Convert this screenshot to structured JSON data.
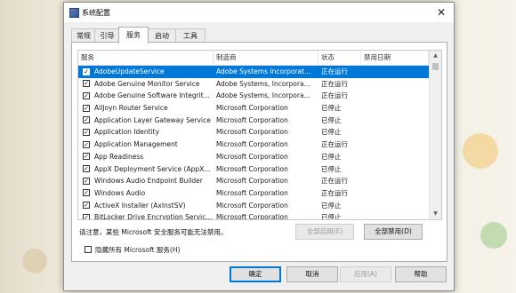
{
  "window": {
    "title": "系统配置",
    "close_glyph": "✕"
  },
  "tabs": [
    {
      "label": "常规",
      "active": false
    },
    {
      "label": "引导",
      "active": false
    },
    {
      "label": "服务",
      "active": true
    },
    {
      "label": "启动",
      "active": false
    },
    {
      "label": "工具",
      "active": false
    }
  ],
  "services": {
    "columns": {
      "service": "服务",
      "manufacturer": "制造商",
      "status": "状态",
      "disabled_date": "禁用日期"
    },
    "rows": [
      {
        "checked": true,
        "name": "AdobeUpdateService",
        "manufacturer": "Adobe Systems Incorporat...",
        "status": "正在运行",
        "selected": true
      },
      {
        "checked": true,
        "name": "Adobe Genuine Monitor Service",
        "manufacturer": "Adobe Systems, Incorpora...",
        "status": "正在运行"
      },
      {
        "checked": true,
        "name": "Adobe Genuine Software Integrit...",
        "manufacturer": "Adobe Systems, Incorpora...",
        "status": "正在运行"
      },
      {
        "checked": true,
        "name": "AllJoyn Router Service",
        "manufacturer": "Microsoft Corporation",
        "status": "已停止"
      },
      {
        "checked": true,
        "name": "Application Layer Gateway Service",
        "manufacturer": "Microsoft Corporation",
        "status": "已停止"
      },
      {
        "checked": true,
        "name": "Application Identity",
        "manufacturer": "Microsoft Corporation",
        "status": "已停止"
      },
      {
        "checked": true,
        "name": "Application Management",
        "manufacturer": "Microsoft Corporation",
        "status": "正在运行"
      },
      {
        "checked": true,
        "name": "App Readiness",
        "manufacturer": "Microsoft Corporation",
        "status": "已停止"
      },
      {
        "checked": true,
        "name": "AppX Deployment Service (AppX...",
        "manufacturer": "Microsoft Corporation",
        "status": "已停止"
      },
      {
        "checked": true,
        "name": "Windows Audio Endpoint Builder",
        "manufacturer": "Microsoft Corporation",
        "status": "正在运行"
      },
      {
        "checked": true,
        "name": "Windows Audio",
        "manufacturer": "Microsoft Corporation",
        "status": "正在运行"
      },
      {
        "checked": true,
        "name": "ActiveX Installer (AxInstSV)",
        "manufacturer": "Microsoft Corporation",
        "status": "已停止"
      },
      {
        "checked": true,
        "name": "BitLocker Drive Encryption Servic...",
        "manufacturer": "Microsoft Corporation",
        "status": "已停止"
      }
    ]
  },
  "note": "请注意，某些 Microsoft 安全服务可能无法禁用。",
  "buttons": {
    "enable_all": "全部启用(E)",
    "disable_all": "全部禁用(D)",
    "ok": "确定",
    "cancel": "取消",
    "apply": "应用(A)",
    "help": "帮助"
  },
  "hide_ms": {
    "label": "隐藏所有 Microsoft 服务(H)",
    "checked": false
  },
  "scrollbar": {
    "up_glyph": "▲",
    "down_glyph": "▼"
  },
  "colors": {
    "selection": "#0078d7",
    "dialog_bg": "#f0f0f0"
  },
  "icons": {
    "checkmark": "✓"
  }
}
